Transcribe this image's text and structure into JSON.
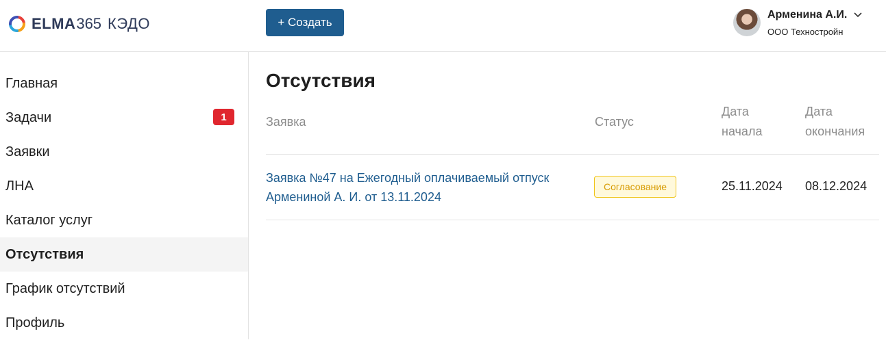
{
  "header": {
    "logo_elma": "ELMA",
    "logo_num": "365",
    "logo_kedo": "КЭДО",
    "create_button": "+ Создать",
    "user": {
      "name": "Арменина А.И.",
      "org": "ООО Техностройн"
    }
  },
  "sidebar": {
    "items": [
      {
        "label": "Главная"
      },
      {
        "label": "Задачи",
        "badge": "1"
      },
      {
        "label": "Заявки"
      },
      {
        "label": "ЛНА"
      },
      {
        "label": "Каталог услуг"
      },
      {
        "label": "Отсутствия",
        "active": true
      },
      {
        "label": "График отсутствий"
      },
      {
        "label": "Профиль"
      }
    ]
  },
  "main": {
    "title": "Отсутствия",
    "columns": {
      "request": "Заявка",
      "status": "Статус",
      "start_line1": "Дата",
      "start_line2": "начала",
      "end_line1": "Дата",
      "end_line2": "окончания"
    },
    "rows": [
      {
        "request": "Заявка №47 на Ежегодный оплачиваемый отпуск Армениной А. И. от 13.11.2024",
        "status": "Согласование",
        "start": "25.11.2024",
        "end": "08.12.2024"
      }
    ]
  },
  "colors": {
    "accent": "#1f5d8f",
    "badge": "#e0262e",
    "status_border": "#f0c419",
    "status_text": "#d79a00"
  }
}
